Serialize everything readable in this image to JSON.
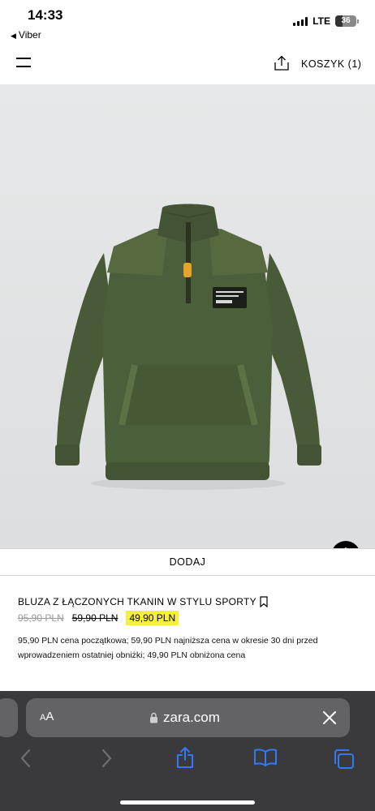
{
  "status_bar": {
    "time": "14:33",
    "back_app": "Viber",
    "network": "LTE",
    "battery_level": "36",
    "battery_fraction": 0.36
  },
  "header": {
    "menu_icon": "hamburger-icon",
    "share_icon": "share-icon",
    "cart_label": "KOSZYK (1)"
  },
  "product": {
    "image_alt": "green-quarter-zip-sweatshirt",
    "add_label": "DODAJ",
    "title": "BLUZA Z ŁĄCZONYCH TKANIN W STYLU SPORTY",
    "price_original": "95,90 PLN",
    "price_previous": "59,90 PLN",
    "price_current": "49,90 PLN",
    "price_note": "95,90 PLN cena początkowa; 59,90 PLN najniższa cena w okresie 30 dni przed wprowadzeniem ostatniej obniżki; 49,90 PLN obniżona cena"
  },
  "safari": {
    "aa_label_small": "A",
    "aa_label_large": "A",
    "url": "zara.com"
  },
  "colors": {
    "highlight": "#f6ef3b",
    "garment": "#4b5f3a",
    "safari_bg": "#3a3a3c",
    "safari_blue": "#3478f6"
  }
}
